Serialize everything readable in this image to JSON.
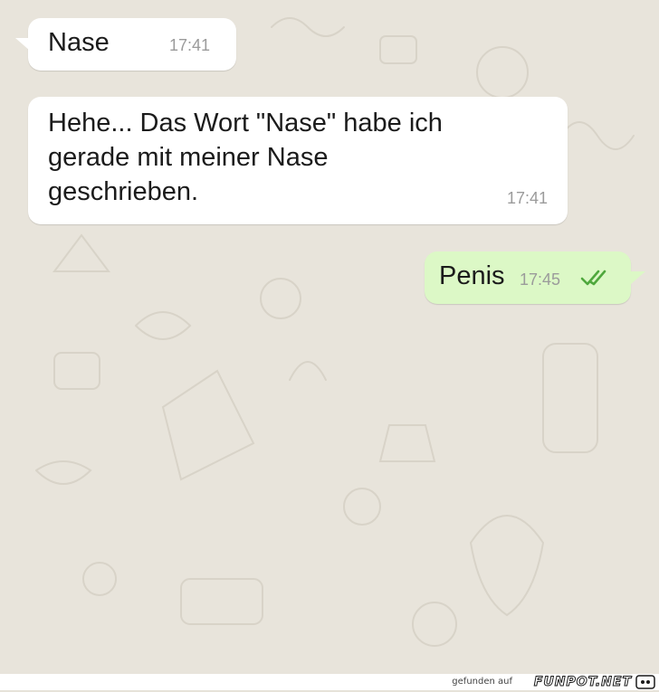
{
  "messages": [
    {
      "direction": "incoming",
      "text": "Nase",
      "time": "17:41"
    },
    {
      "direction": "incoming",
      "text": "Hehe... Das Wort \"Nase\" habe ich gerade mit meiner Nase geschrieben.",
      "time": "17:41"
    },
    {
      "direction": "outgoing",
      "text": "Penis",
      "time": "17:45",
      "status_icon": "double-check-icon"
    }
  ],
  "footer": {
    "label": "gefunden auf",
    "brand": "FUNPOT.NET",
    "icon": "funpot-logo-icon"
  },
  "colors": {
    "background": "#e8e4db",
    "incoming_bubble": "#ffffff",
    "outgoing_bubble": "#dcf8c6",
    "read_ticks": "#4fa83d",
    "time_text": "#9b9b9b"
  }
}
